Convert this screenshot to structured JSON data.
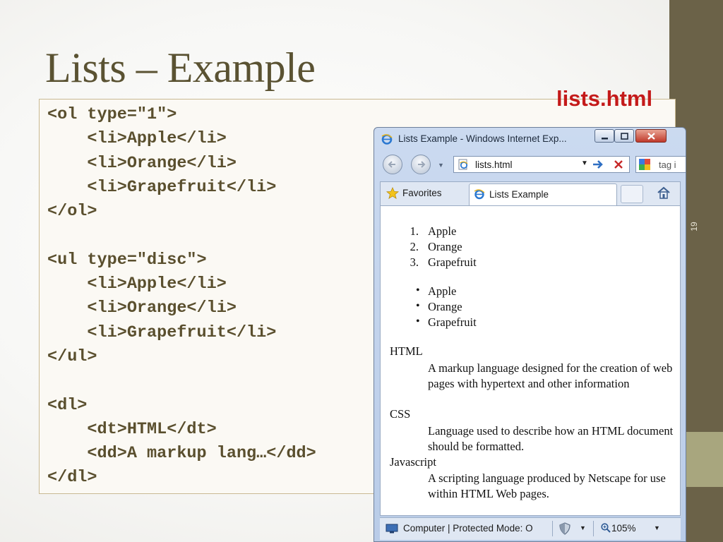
{
  "slide": {
    "title": "Lists – Example",
    "file_label": "lists.html",
    "slide_number": "19",
    "code_lines": [
      "<ol type=\"1\">",
      "    <li>Apple</li>",
      "    <li>Orange</li>",
      "    <li>Grapefruit</li>",
      "</ol>",
      "",
      "<ul type=\"disc\">",
      "    <li>Apple</li>",
      "    <li>Orange</li>",
      "    <li>Grapefruit</li>",
      "</ul>",
      "",
      "<dl>",
      "    <dt>HTML</dt>",
      "    <dd>A markup lang…</dd>",
      "</dl>"
    ]
  },
  "browser": {
    "window_title": "Lists Example - Windows Internet Exp...",
    "address": "lists.html",
    "search_text": "tag i",
    "favorites_label": "Favorites",
    "tab_label": "Lists Example",
    "status_text": "Computer | Protected Mode: O",
    "zoom_text": "105%",
    "icons": {
      "window": "ie-logo-icon",
      "back": "back-arrow-icon",
      "forward": "forward-arrow-icon",
      "go": "go-arrow-icon",
      "stop": "stop-icon",
      "search_provider": "google-icon",
      "favorites": "star-icon",
      "home": "home-icon",
      "status": "computer-icon",
      "security": "shield-icon",
      "zoom": "magnifier-icon"
    },
    "colors": {
      "chrome": "#c5d5ee",
      "close_button": "#c0392b",
      "go_arrow": "#2f6fc3",
      "stop_x": "#c62828"
    },
    "page": {
      "ordered_list": [
        {
          "marker": "1.",
          "text": "Apple"
        },
        {
          "marker": "2.",
          "text": "Orange"
        },
        {
          "marker": "3.",
          "text": "Grapefruit"
        }
      ],
      "unordered_list": [
        {
          "marker": "•",
          "text": "Apple"
        },
        {
          "marker": "•",
          "text": "Orange"
        },
        {
          "marker": "•",
          "text": "Grapefruit"
        }
      ],
      "definitions": [
        {
          "term": "HTML",
          "description": "A markup language designed for the creation of web pages with hypertext and other information"
        },
        {
          "term": "CSS",
          "description": "Language used to describe how an HTML document should be formatted."
        },
        {
          "term": "Javascript",
          "description": "A scripting language produced by Netscape for use within HTML Web pages."
        }
      ]
    }
  },
  "colors": {
    "title_text": "#5a5232",
    "code_text": "#5a4f2e",
    "file_label": "#c41a1a",
    "side_band": "#6b6248",
    "side_band_accent": "#a8a67e"
  }
}
